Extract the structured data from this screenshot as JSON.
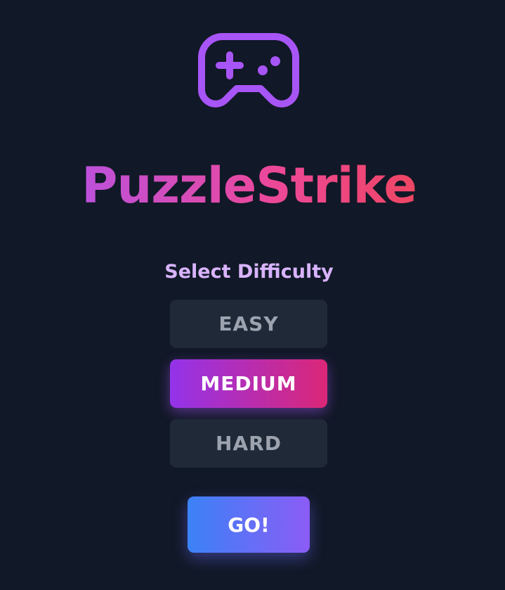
{
  "app": {
    "title": "PuzzleStrike",
    "logo_icon": "gamepad-icon"
  },
  "difficulty": {
    "heading": "Select Difficulty",
    "options": [
      {
        "label": "EASY",
        "selected": false
      },
      {
        "label": "MEDIUM",
        "selected": true
      },
      {
        "label": "HARD",
        "selected": false
      }
    ]
  },
  "actions": {
    "go_label": "GO!"
  },
  "colors": {
    "background": "#111827",
    "accent_purple": "#a855f7",
    "accent_pink": "#ec4899",
    "accent_red": "#ef4444",
    "subtitle": "#d8b4fe",
    "button_idle": "#1f2937",
    "button_idle_text": "#9ca3af",
    "go_gradient_start": "#3b82f6",
    "go_gradient_end": "#8b5cf6"
  }
}
